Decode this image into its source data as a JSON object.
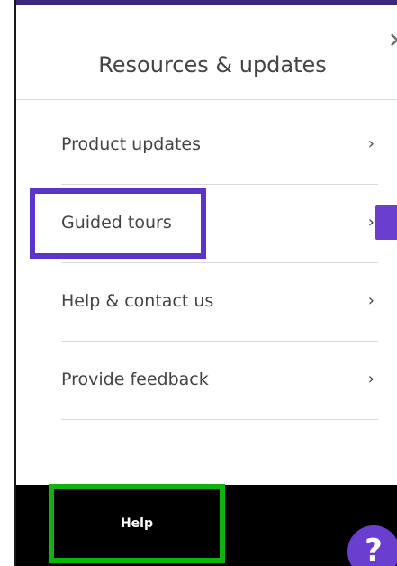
{
  "panel": {
    "title": "Resources & updates",
    "close_icon": "close-icon",
    "items": [
      {
        "label": "Product updates",
        "chevron": "›"
      },
      {
        "label": "Guided tours",
        "chevron": "›"
      },
      {
        "label": "Help & contact us",
        "chevron": "›"
      },
      {
        "label": "Provide feedback",
        "chevron": "›"
      }
    ]
  },
  "footer": {
    "help_label": "Help",
    "fab_symbol": "?"
  },
  "colors": {
    "accent_purple": "#6a3fd0",
    "highlight_purple": "#5a35c8",
    "highlight_green": "#12b112",
    "bar_black": "#000000"
  }
}
